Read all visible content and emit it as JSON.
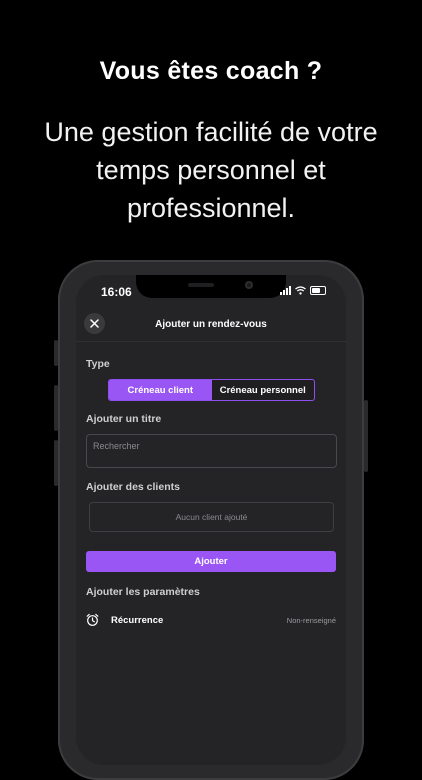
{
  "marketing": {
    "headline": "Vous êtes coach ?",
    "subline": "Une gestion facilité de votre temps personnel et professionnel."
  },
  "status_bar": {
    "time": "16:06",
    "icons": [
      "signal-icon",
      "wifi-icon",
      "battery-icon"
    ]
  },
  "nav": {
    "title": "Ajouter un rendez-vous",
    "close_icon": "close-icon"
  },
  "type_section": {
    "label": "Type",
    "options": [
      "Créneau client",
      "Créneau personnel"
    ],
    "selected": "Créneau client"
  },
  "title_section": {
    "label": "Ajouter un titre",
    "placeholder": "Rechercher"
  },
  "clients_section": {
    "label": "Ajouter des clients",
    "empty_text": "Aucun client ajouté"
  },
  "add_button": {
    "label": "Ajouter"
  },
  "params_section": {
    "label": "Ajouter les paramètres",
    "items": [
      {
        "icon": "alarm-clock-icon",
        "label": "Récurrence",
        "value": "Non-renseigné"
      }
    ]
  },
  "colors": {
    "accent": "#9a55f5",
    "background": "#000000",
    "screen": "#242426"
  }
}
